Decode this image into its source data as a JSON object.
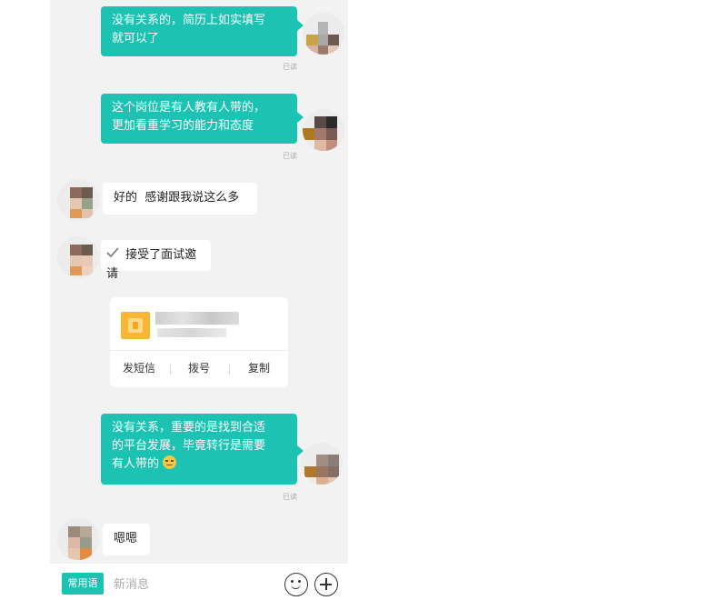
{
  "messages": [
    {
      "direction": "sent",
      "lines": [
        "没有关系的，简历上如实填写",
        "就可以了"
      ],
      "read": "已读"
    },
    {
      "direction": "sent",
      "lines": [
        "这个岗位是有人教有人带的，",
        "更加看重学习的能力和态度"
      ],
      "read": "已读"
    },
    {
      "direction": "received",
      "text": "好的  感谢跟我说这么多"
    },
    {
      "direction": "received",
      "text": "接受了面试邀请",
      "icon": "check-icon"
    },
    {
      "direction": "sent",
      "lines": [
        "没有关系，重要的是找到合适",
        "的平台发展，毕竟转行是需要",
        "有人带的"
      ],
      "emoji": "smile-emoji",
      "read": "已读"
    },
    {
      "direction": "received",
      "text": "嗯嗯"
    }
  ],
  "contact_card": {
    "icon": "contact-card-icon",
    "actions": [
      "发短信",
      "拨号",
      "复制"
    ]
  },
  "input_bar": {
    "phrases_label": "常用语",
    "placeholder": "新消息",
    "emoji_icon": "emoji-icon",
    "plus_icon": "plus-icon"
  },
  "colors": {
    "accent": "#1cc3b3",
    "panel_bg": "#f2f2f2"
  }
}
